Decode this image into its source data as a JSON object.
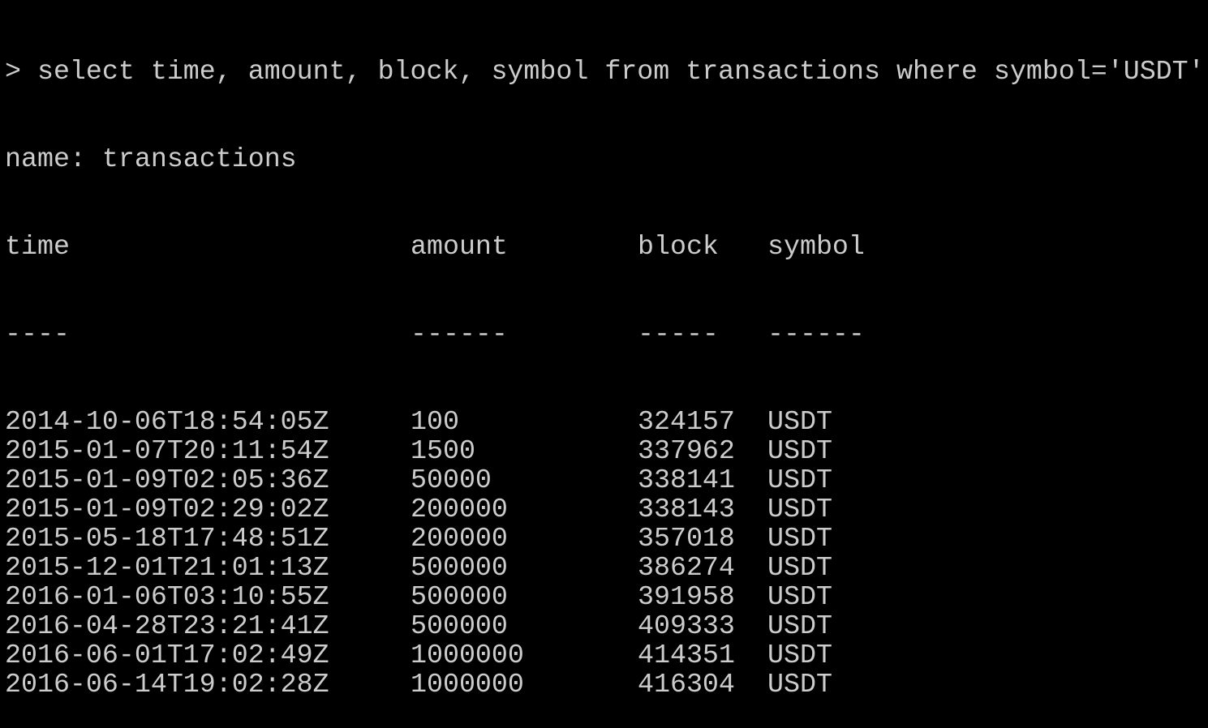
{
  "terminal": {
    "prompt_symbol": ">",
    "command": "select time, amount, block, symbol from transactions where symbol='USDT'",
    "result_name_line": "name: transactions",
    "columns": [
      "time",
      "amount",
      "block",
      "symbol"
    ],
    "separators": [
      "----",
      "------",
      "-----",
      "------"
    ],
    "rows": [
      [
        "2014-10-06T18:54:05Z",
        "100",
        "324157",
        "USDT"
      ],
      [
        "2015-01-07T20:11:54Z",
        "1500",
        "337962",
        "USDT"
      ],
      [
        "2015-01-09T02:05:36Z",
        "50000",
        "338141",
        "USDT"
      ],
      [
        "2015-01-09T02:29:02Z",
        "200000",
        "338143",
        "USDT"
      ],
      [
        "2015-05-18T17:48:51Z",
        "200000",
        "357018",
        "USDT"
      ],
      [
        "2015-12-01T21:01:13Z",
        "500000",
        "386274",
        "USDT"
      ],
      [
        "2016-01-06T03:10:55Z",
        "500000",
        "391958",
        "USDT"
      ],
      [
        "2016-04-28T23:21:41Z",
        "500000",
        "409333",
        "USDT"
      ],
      [
        "2016-06-01T17:02:49Z",
        "1000000",
        "414351",
        "USDT"
      ],
      [
        "2016-06-14T19:02:28Z",
        "1000000",
        "416304",
        "USDT"
      ]
    ]
  },
  "colors": {
    "background": "#000000",
    "text": "#cccccc"
  }
}
